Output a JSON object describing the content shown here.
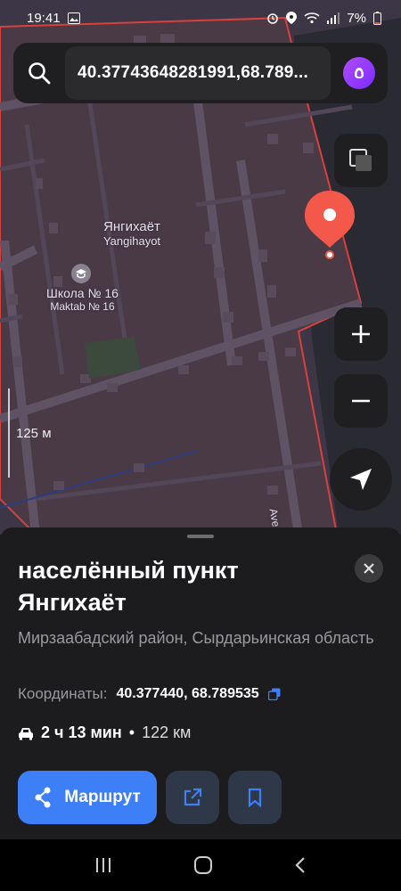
{
  "status_bar": {
    "time": "19:41",
    "battery": "7%"
  },
  "search": {
    "value": "40.37743648281991,68.789..."
  },
  "map": {
    "place_name_ru": "Янгихаёт",
    "place_name_uz": "Yangihayot",
    "school_name_ru": "Школа № 16",
    "school_name_uz": "Maktab № 16",
    "street_fragment": "Ave",
    "scale": "125 м"
  },
  "place": {
    "title": "населённый пункт Янгихаёт",
    "subtitle": "Мирзаабадский район, Сырдарьинская область",
    "coords_label": "Координаты:",
    "coords_value": "40.377440, 68.789535",
    "route_time": "2 ч 13 мин",
    "route_sep": "•",
    "route_distance": "122 км",
    "route_button": "Маршрут"
  },
  "colors": {
    "accent": "#3d7ff7",
    "pin": "#f4584a",
    "alice": "#8b36ff"
  }
}
